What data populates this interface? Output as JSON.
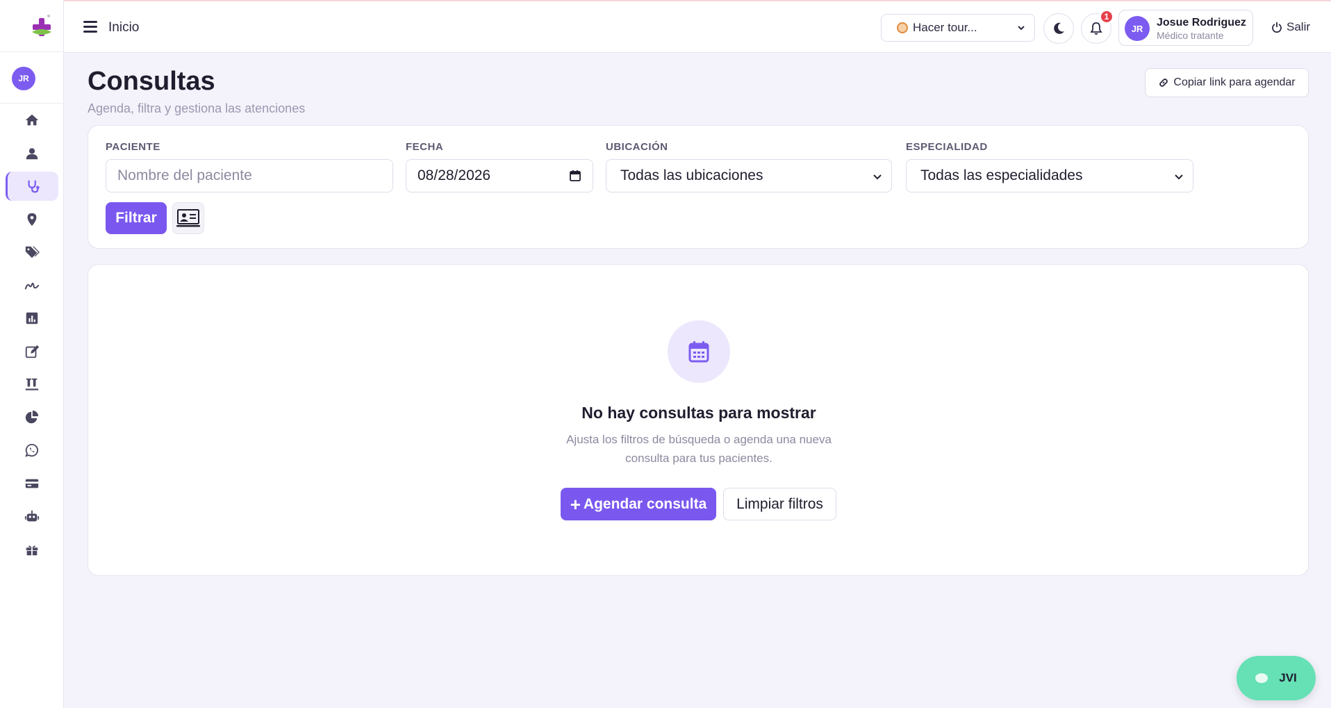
{
  "header": {
    "title": "Inicio",
    "tour_select": "Hacer tour...",
    "notification_count": "1",
    "user": {
      "initials": "JR",
      "name": "Josue Rodriguez",
      "role": "Médico tratante"
    },
    "logout_label": "Salir"
  },
  "sidebar": {
    "avatar_initials": "JR",
    "items": [
      {
        "name": "home-icon",
        "active": false
      },
      {
        "name": "user-icon",
        "active": false
      },
      {
        "name": "stethoscope-icon",
        "active": true
      },
      {
        "name": "map-pin-icon",
        "active": false
      },
      {
        "name": "tags-icon",
        "active": false
      },
      {
        "name": "signature-icon",
        "active": false
      },
      {
        "name": "bar-chart-icon",
        "active": false
      },
      {
        "name": "edit-icon",
        "active": false
      },
      {
        "name": "vials-icon",
        "active": false
      },
      {
        "name": "pie-chart-icon",
        "active": false
      },
      {
        "name": "whatsapp-icon",
        "active": false
      },
      {
        "name": "credit-card-icon",
        "active": false
      },
      {
        "name": "robot-icon",
        "active": false
      },
      {
        "name": "gift-icon",
        "active": false
      }
    ]
  },
  "page": {
    "title": "Consultas",
    "subtitle": "Agenda, filtra y gestiona las atenciones",
    "copy_link_label": "Copiar link para agendar"
  },
  "filters": {
    "patient_label": "PACIENTE",
    "patient_placeholder": "Nombre del paciente",
    "date_label": "FECHA",
    "date_value": "08/28/2026",
    "location_label": "UBICACIÓN",
    "location_value": "Todas las ubicaciones",
    "specialty_label": "ESPECIALIDAD",
    "specialty_value": "Todas las especialidades",
    "filter_button": "Filtrar"
  },
  "empty_state": {
    "title": "No hay consultas para mostrar",
    "description": "Ajusta los filtros de búsqueda o agenda una nueva consulta para tus pacientes.",
    "schedule_button": "Agendar consulta",
    "clear_button": "Limpiar filtros"
  },
  "chat": {
    "label": "JVI"
  },
  "colors": {
    "accent": "#7a58ef",
    "badge": "#e5414d",
    "chat": "#66e0b5"
  }
}
